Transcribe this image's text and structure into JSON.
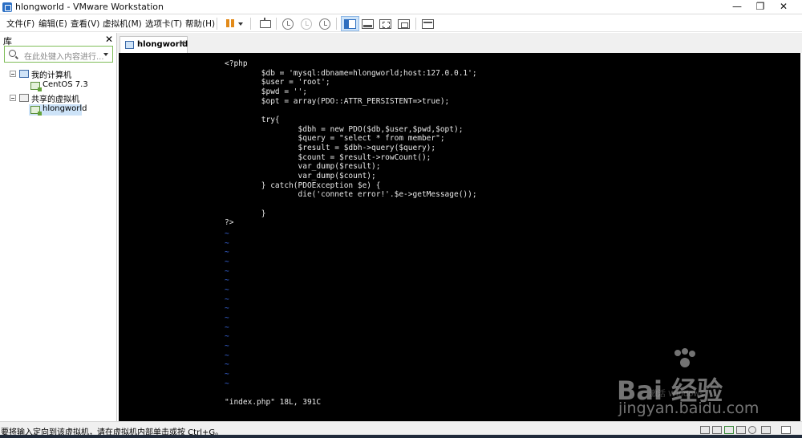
{
  "window": {
    "title": "hlongworld - VMware Workstation",
    "controls": {
      "minimize": "—",
      "maximize": "❐",
      "close": "✕"
    }
  },
  "menu": [
    "文件(F)",
    "编辑(E)",
    "查看(V)",
    "虚拟机(M)",
    "选项卡(T)",
    "帮助(H)"
  ],
  "library": {
    "title": "库",
    "close": "✕",
    "search_placeholder": "在此处键入内容进行...",
    "tree": {
      "my_computer": "我的计算机",
      "vm_centos": "CentOS 7.3",
      "shared": "共享的虚拟机",
      "vm_hlong": "hlongworld"
    }
  },
  "tab": {
    "label": "hlongworld",
    "close": "✕"
  },
  "console": {
    "code": "<?php\n        $db = 'mysql:dbname=hlongworld;host:127.0.0.1';\n        $user = 'root';\n        $pwd = '';\n        $opt = array(PDO::ATTR_PERSISTENT=>true);\n\n        try{\n                $dbh = new PDO($db,$user,$pwd,$opt);\n                $query = \"select * from member\";\n                $result = $dbh->query($query);\n                $count = $result->rowCount();\n                var_dump($result);\n                var_dump($count);\n        } catch(PDOException $e) {\n                die('connete error!'.$e->getMessage());\n\n        }\n?>",
    "tildes": "~\n~\n~\n~\n~\n~\n~\n~\n~\n~\n~\n~\n~\n~\n~\n~\n~",
    "vim_status": "\"index.php\" 18L, 391C"
  },
  "watermark": {
    "main": "Bai 经验",
    "sub": "jingyan.baidu.com",
    "faint": "激活 Windows"
  },
  "status": {
    "text": "要将输入定向到该虚拟机，请在虚拟机内部单击或按 Ctrl+G。"
  },
  "colors": {
    "console_bg": "#000000",
    "vim_tilde": "#3a68e0",
    "search_border": "#7fbd59",
    "pause_icon": "#e28a19"
  }
}
